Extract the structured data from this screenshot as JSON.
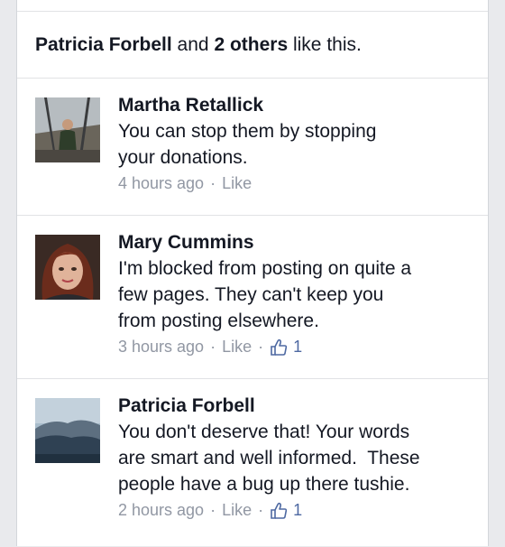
{
  "summary": {
    "name": "Patricia Forbell",
    "and_text": " and ",
    "others": "2 others",
    "like_text": " like this."
  },
  "comments": [
    {
      "author": "Martha Retallick",
      "text_lines": [
        "You can stop them by stopping",
        "your donations."
      ],
      "time": "4 hours ago",
      "like_label": "Like",
      "likes": null
    },
    {
      "author": "Mary Cummins",
      "text_lines": [
        "I'm blocked from posting on quite a",
        "few pages. They can't keep you",
        "from posting elsewhere."
      ],
      "time": "3 hours ago",
      "like_label": "Like",
      "likes": "1"
    },
    {
      "author": "Patricia Forbell",
      "text_lines": [
        "You don't deserve that! Your words",
        "are smart and well informed.  These",
        "people have a bug up there tushie."
      ],
      "time": "2 hours ago",
      "like_label": "Like",
      "likes": "1"
    }
  ],
  "separator": "·",
  "colors": {
    "meta_gray": "#9197a3",
    "link_blue": "#4e69a2",
    "text": "#141823"
  },
  "icons": [
    "thumbs-up-icon"
  ]
}
